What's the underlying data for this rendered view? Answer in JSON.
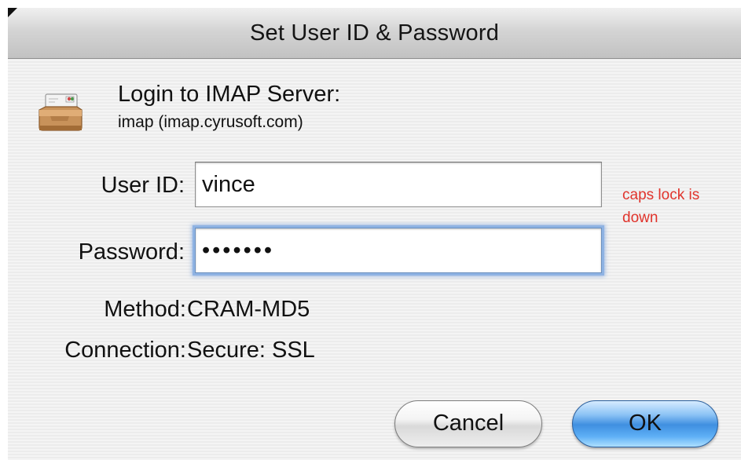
{
  "window": {
    "title": "Set User ID & Password"
  },
  "header": {
    "title": "Login to IMAP Server:",
    "server": "imap (imap.cyrusoft.com)",
    "icon": "mail-tray-icon"
  },
  "form": {
    "user_id_label": "User ID:",
    "user_id_value": "vince",
    "password_label": "Password:",
    "password_value": "•••••••",
    "caps_lock_warning": "caps lock is down"
  },
  "info": {
    "method_label": "Method:",
    "method_value": "CRAM-MD5",
    "connection_label": "Connection:",
    "connection_value": "Secure: SSL"
  },
  "buttons": {
    "cancel_label": "Cancel",
    "ok_label": "OK"
  },
  "colors": {
    "warning": "#e0332b",
    "focus_ring": "#8fb3e3",
    "default_button": "#3f8fe0"
  }
}
